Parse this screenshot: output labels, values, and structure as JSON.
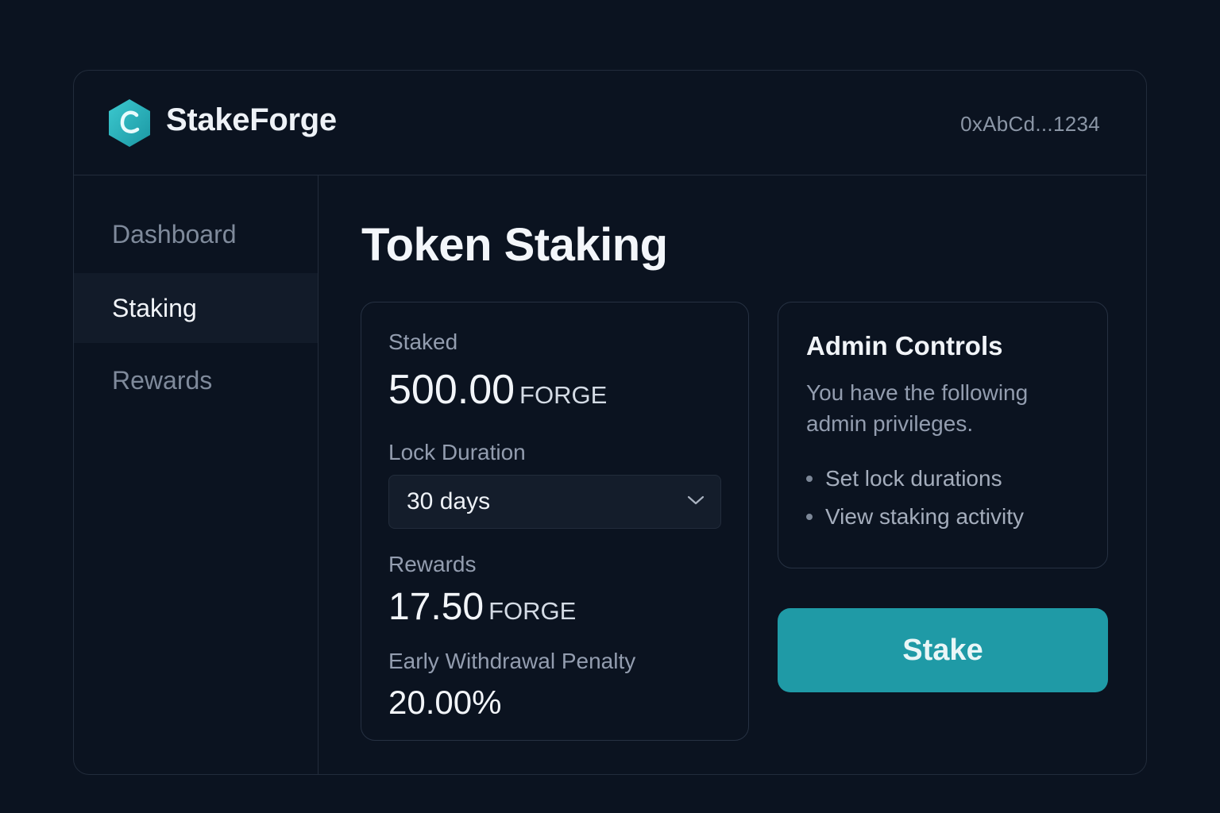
{
  "header": {
    "brand": "StakeForge",
    "wallet_address": "0xAbCd...1234",
    "logo_icon": "hexagon-c-logo-icon"
  },
  "sidebar": {
    "items": [
      {
        "label": "Dashboard",
        "active": false
      },
      {
        "label": "Staking",
        "active": true
      },
      {
        "label": "Rewards",
        "active": false
      }
    ]
  },
  "main": {
    "title": "Token Staking",
    "staking": {
      "staked_label": "Staked",
      "staked_value": "500.00",
      "staked_unit": "FORGE",
      "lock_label": "Lock Duration",
      "lock_selected": "30 days",
      "rewards_label": "Rewards",
      "rewards_value": "17.50",
      "rewards_unit": "FORGE",
      "penalty_label": "Early Withdrawal Penalty",
      "penalty_value": "20.00%"
    },
    "admin": {
      "title": "Admin Controls",
      "description": "You have the following admin privileges.",
      "privileges": [
        "Set lock durations",
        "View staking activity"
      ]
    },
    "stake_button": "Stake"
  },
  "colors": {
    "background": "#0b1320",
    "accent": "#1f9aa6",
    "logo": "#2cb7c0"
  }
}
